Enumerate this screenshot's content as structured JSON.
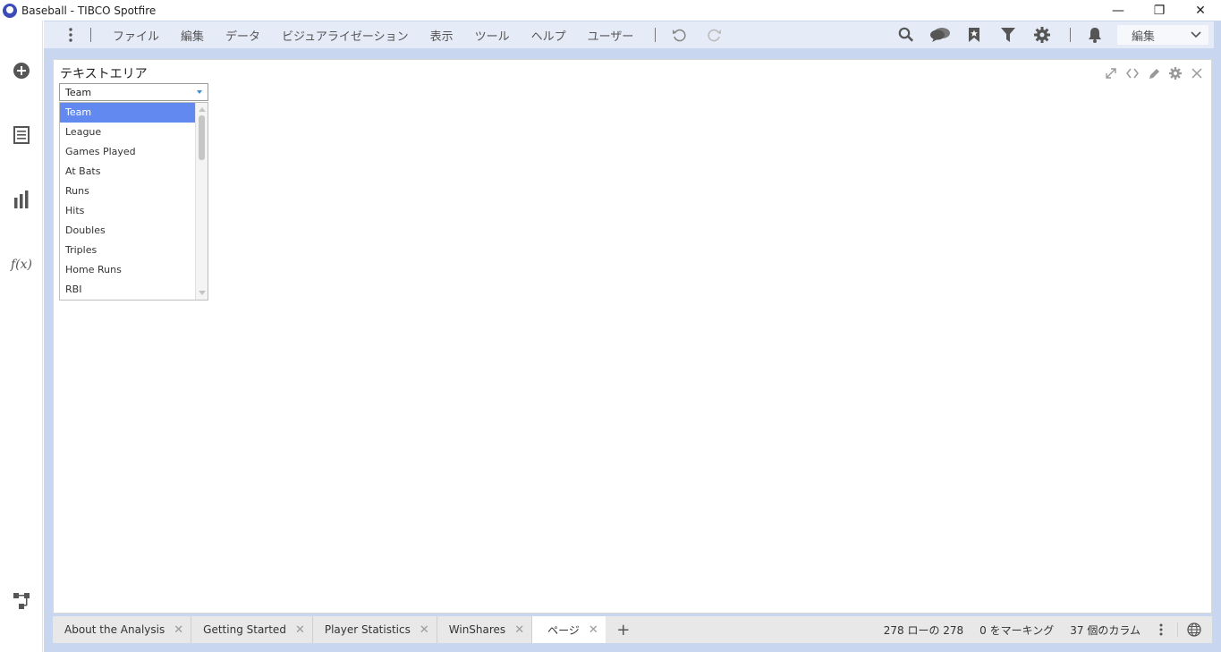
{
  "window": {
    "title": "Baseball - TIBCO Spotfire",
    "minimize_label": "—",
    "restore_label": "❐",
    "close_label": "✕"
  },
  "menu": {
    "items": [
      "ファイル",
      "編集",
      "データ",
      "ビジュアライゼーション",
      "表示",
      "ツール",
      "ヘルプ",
      "ユーザー"
    ]
  },
  "mode_select": {
    "value": "編集"
  },
  "panel": {
    "title": "テキストエリア",
    "dropdown": {
      "value": "Team"
    },
    "list": {
      "items": [
        "Team",
        "League",
        "Games Played",
        "At Bats",
        "Runs",
        "Hits",
        "Doubles",
        "Triples",
        "Home Runs",
        "RBI"
      ],
      "selected_index": 0
    }
  },
  "tabs": [
    {
      "label": "About the Analysis",
      "close": "✕"
    },
    {
      "label": "Getting Started",
      "close": "✕"
    },
    {
      "label": "Player Statistics",
      "close": "✕"
    },
    {
      "label": "WinShares",
      "close": "✕"
    },
    {
      "label": "ページ",
      "close": "✕"
    }
  ],
  "add_tab_label": "+",
  "status": {
    "rows": "278 ローの 278",
    "marked": "0 をマーキング",
    "columns": "37 個のカラム"
  },
  "colors": {
    "frame": "#c9d6f0",
    "toolbar": "#e6ebf8",
    "selected": "#6289f0",
    "logo": "#3b4bb8"
  }
}
